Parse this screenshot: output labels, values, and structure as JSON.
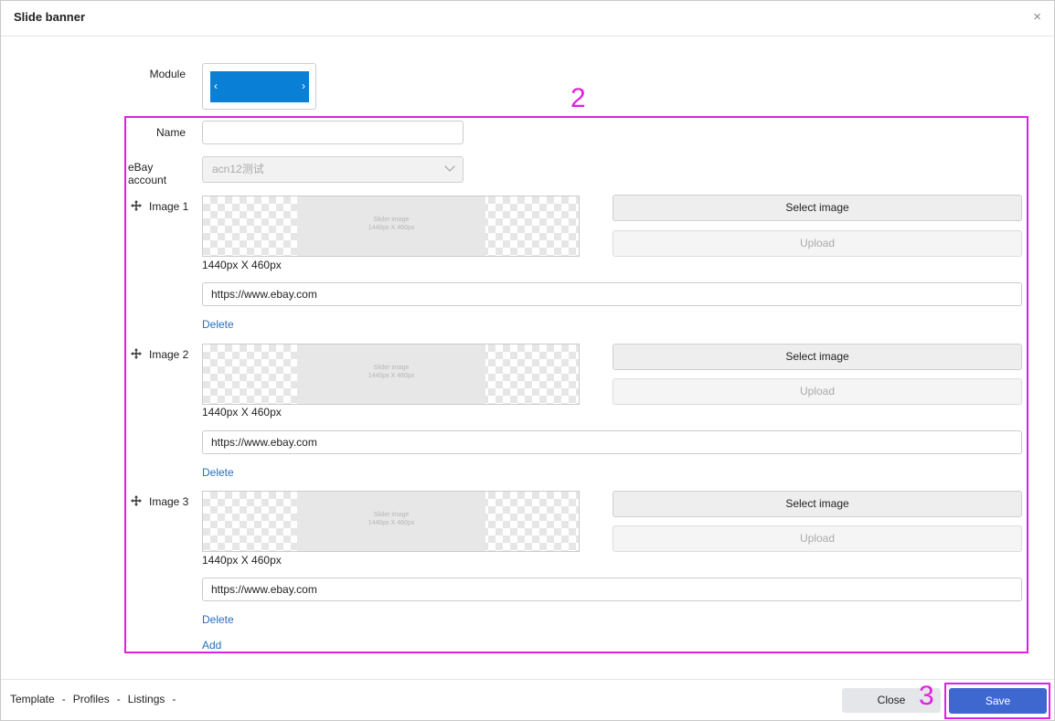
{
  "dialog": {
    "title": "Slide banner",
    "close_glyph": "×"
  },
  "form": {
    "module_label": "Module",
    "module_preview": {
      "left_arrow": "‹",
      "right_arrow": "›"
    },
    "name_label": "Name",
    "name_value": "",
    "account_label": "eBay account",
    "account_value": "acn12测试"
  },
  "images": [
    {
      "label": "Image 1",
      "placeholder_line1": "Slider image",
      "placeholder_line2": "1440px X 460px",
      "size_note": "1440px X 460px",
      "select_label": "Select image",
      "upload_label": "Upload",
      "url": "https://www.ebay.com",
      "delete_label": "Delete"
    },
    {
      "label": "Image 2",
      "placeholder_line1": "Slider image",
      "placeholder_line2": "1440px X 460px",
      "size_note": "1440px X 460px",
      "select_label": "Select image",
      "upload_label": "Upload",
      "url": "https://www.ebay.com",
      "delete_label": "Delete"
    },
    {
      "label": "Image 3",
      "placeholder_line1": "Slider image",
      "placeholder_line2": "1440px X 460px",
      "size_note": "1440px X 460px",
      "select_label": "Select image",
      "upload_label": "Upload",
      "url": "https://www.ebay.com",
      "delete_label": "Delete"
    }
  ],
  "add_label": "Add",
  "annotations": {
    "section": "2",
    "save": "3",
    "color": "#e020e0"
  },
  "footer": {
    "links": [
      "Template",
      "Profiles",
      "Listings"
    ],
    "separator": "-",
    "close_label": "Close",
    "save_label": "Save"
  },
  "colors": {
    "primary": "#3e67cf",
    "module_blue": "#0a7fd6",
    "link": "#2a6ebd"
  }
}
